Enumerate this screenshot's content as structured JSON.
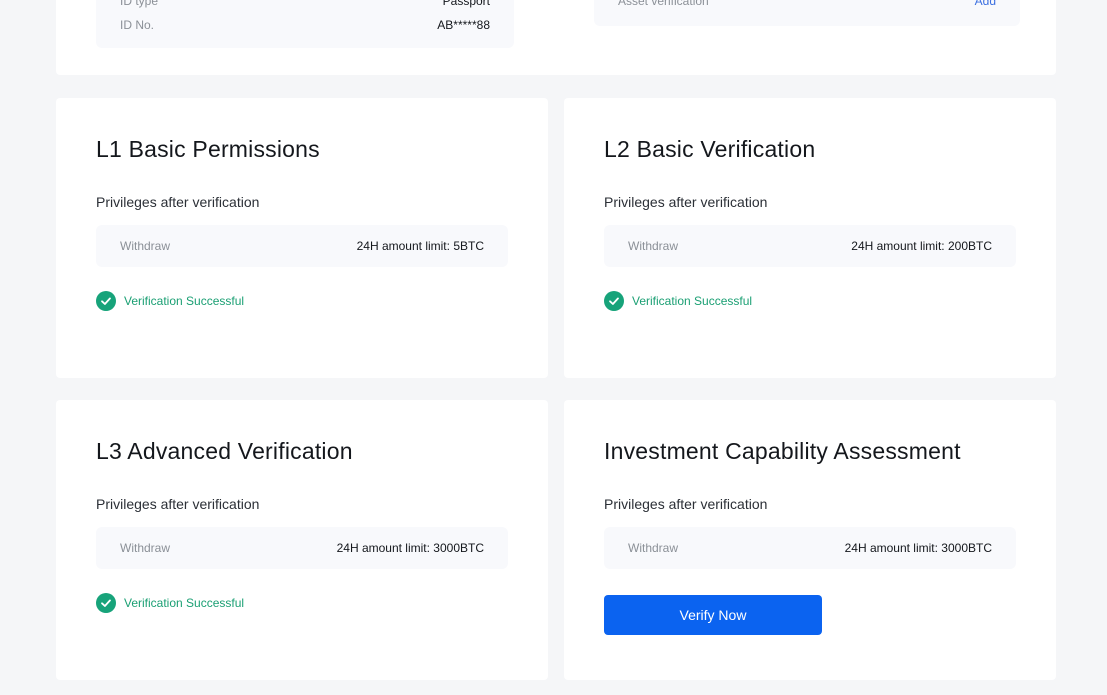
{
  "identity": {
    "id_type_label": "ID type",
    "id_type_value": "Passport",
    "id_no_label": "ID No.",
    "id_no_value": "AB*****88",
    "asset_label": "Asset verification",
    "asset_action": "Add"
  },
  "cards": [
    {
      "title": "L1 Basic Permissions",
      "subtitle": "Privileges after verification",
      "limit_label": "Withdraw",
      "limit_value": "24H amount limit: 5BTC",
      "status": "Verification Successful"
    },
    {
      "title": "L2 Basic Verification",
      "subtitle": "Privileges after verification",
      "limit_label": "Withdraw",
      "limit_value": "24H amount limit: 200BTC",
      "status": "Verification Successful"
    },
    {
      "title": "L3 Advanced Verification",
      "subtitle": "Privileges after verification",
      "limit_label": "Withdraw",
      "limit_value": "24H amount limit: 3000BTC",
      "status": "Verification Successful"
    },
    {
      "title": "Investment Capability Assessment",
      "subtitle": "Privileges after verification",
      "limit_label": "Withdraw",
      "limit_value": "24H amount limit: 3000BTC",
      "button": "Verify Now"
    }
  ],
  "colors": {
    "success": "#1a9f73",
    "primary_button": "#0b63f0",
    "link": "#3b6fe0"
  }
}
